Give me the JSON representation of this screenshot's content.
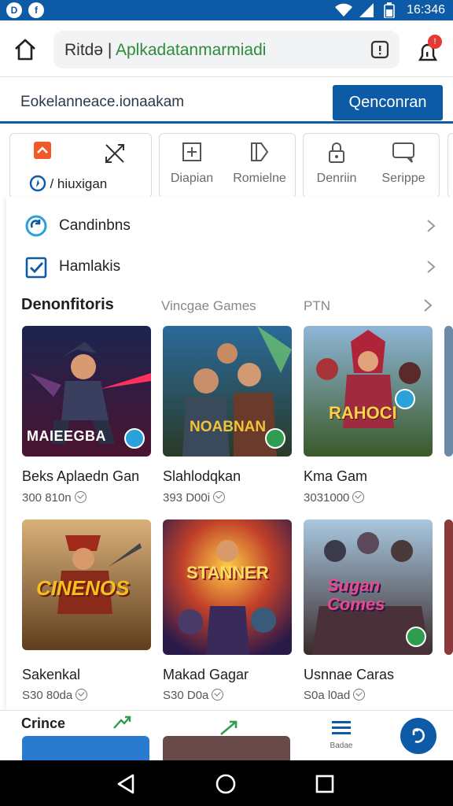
{
  "status_bar": {
    "left_badges": [
      "D",
      "f"
    ],
    "time": "16:346"
  },
  "browser": {
    "url_prefix": "Ritdə | ",
    "url_highlight": "Aplkadatanmarmiadi",
    "url_display": "Ritdə | Aplkadatanmarmiadi",
    "notification_count": "!"
  },
  "site": {
    "title": "Eokelanneace.ionaakam",
    "cta_label": "Qenconran"
  },
  "categories": [
    {
      "label": "/ hiuxigan",
      "icon": "arrow-up-icon"
    },
    {
      "label": "",
      "icon": "crossed-arrows-icon"
    },
    {
      "label": "Diapian",
      "icon": "plus-frame-icon"
    },
    {
      "label": "Romielne",
      "icon": "play-page-icon"
    },
    {
      "label": "Denriin",
      "icon": "lock-icon"
    },
    {
      "label": "Serippe",
      "icon": "chat-icon"
    }
  ],
  "menu": [
    {
      "label": "Candinbns",
      "icon": "refresh-circle-icon"
    },
    {
      "label": "Hamlakis",
      "icon": "checkbox-icon"
    }
  ],
  "section": {
    "title": "Denonfitoris",
    "link1": "Vincgae Games",
    "link2": "PTN"
  },
  "games": [
    {
      "name": "Beks Aplaedn Gan",
      "meta": "300 810n",
      "banner": "MAIEEGBA"
    },
    {
      "name": "Slahlodqkan",
      "meta": "393 D00i",
      "banner": "NOABNAN"
    },
    {
      "name": "Kma Gam",
      "meta": "3031000",
      "banner": "RAHOCI"
    },
    {
      "name": "Sakenkal",
      "meta": "S30 80da",
      "banner": "CINENOS"
    },
    {
      "name": "Makad Gagar",
      "meta": "S30 D0a",
      "banner": "STANNER"
    },
    {
      "name": "Usnnae Caras",
      "meta": "S0a l0ad",
      "banner": "Sugan Comes"
    }
  ],
  "bottom": {
    "label": "Crince",
    "menu_label": "Badae"
  },
  "colors": {
    "primary": "#0d5aa6",
    "accent_orange": "#f05a28",
    "notification_red": "#e53935",
    "badge_teal": "#2aa2d9",
    "badge_green": "#2e9d4f"
  }
}
